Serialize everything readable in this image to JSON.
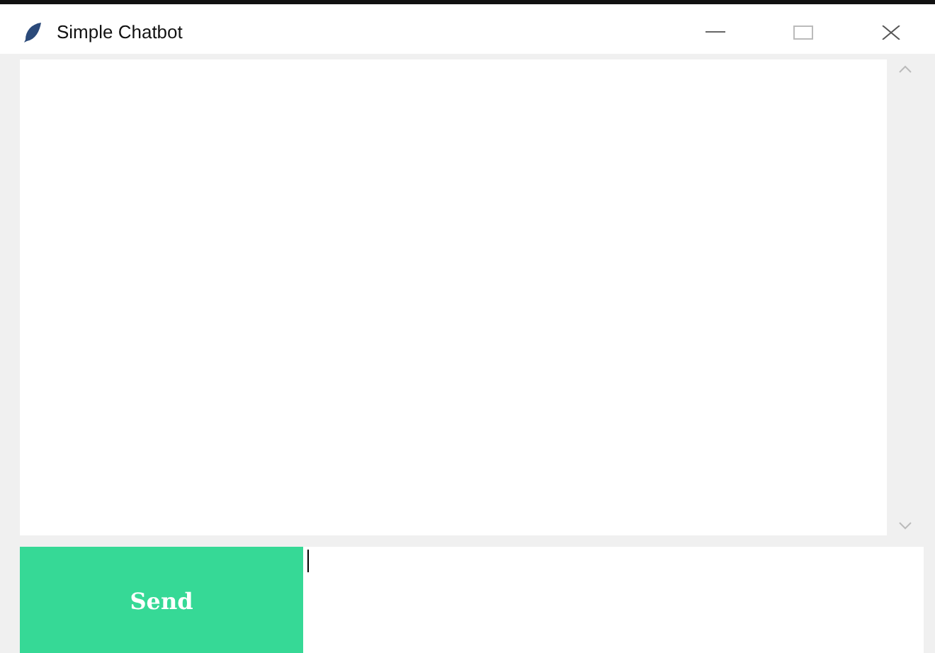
{
  "window": {
    "title": "Simple Chatbot"
  },
  "input_row": {
    "send_button": "Send"
  }
}
